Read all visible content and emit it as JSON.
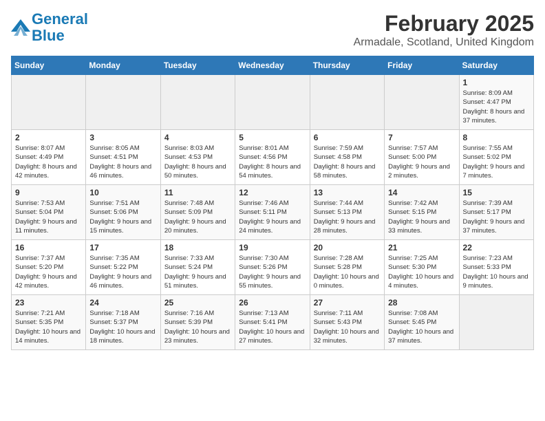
{
  "header": {
    "logo_line1": "General",
    "logo_line2": "Blue",
    "title": "February 2025",
    "subtitle": "Armadale, Scotland, United Kingdom"
  },
  "weekdays": [
    "Sunday",
    "Monday",
    "Tuesday",
    "Wednesday",
    "Thursday",
    "Friday",
    "Saturday"
  ],
  "weeks": [
    [
      {
        "day": "",
        "info": ""
      },
      {
        "day": "",
        "info": ""
      },
      {
        "day": "",
        "info": ""
      },
      {
        "day": "",
        "info": ""
      },
      {
        "day": "",
        "info": ""
      },
      {
        "day": "",
        "info": ""
      },
      {
        "day": "1",
        "info": "Sunrise: 8:09 AM\nSunset: 4:47 PM\nDaylight: 8 hours and 37 minutes."
      }
    ],
    [
      {
        "day": "2",
        "info": "Sunrise: 8:07 AM\nSunset: 4:49 PM\nDaylight: 8 hours and 42 minutes."
      },
      {
        "day": "3",
        "info": "Sunrise: 8:05 AM\nSunset: 4:51 PM\nDaylight: 8 hours and 46 minutes."
      },
      {
        "day": "4",
        "info": "Sunrise: 8:03 AM\nSunset: 4:53 PM\nDaylight: 8 hours and 50 minutes."
      },
      {
        "day": "5",
        "info": "Sunrise: 8:01 AM\nSunset: 4:56 PM\nDaylight: 8 hours and 54 minutes."
      },
      {
        "day": "6",
        "info": "Sunrise: 7:59 AM\nSunset: 4:58 PM\nDaylight: 8 hours and 58 minutes."
      },
      {
        "day": "7",
        "info": "Sunrise: 7:57 AM\nSunset: 5:00 PM\nDaylight: 9 hours and 2 minutes."
      },
      {
        "day": "8",
        "info": "Sunrise: 7:55 AM\nSunset: 5:02 PM\nDaylight: 9 hours and 7 minutes."
      }
    ],
    [
      {
        "day": "9",
        "info": "Sunrise: 7:53 AM\nSunset: 5:04 PM\nDaylight: 9 hours and 11 minutes."
      },
      {
        "day": "10",
        "info": "Sunrise: 7:51 AM\nSunset: 5:06 PM\nDaylight: 9 hours and 15 minutes."
      },
      {
        "day": "11",
        "info": "Sunrise: 7:48 AM\nSunset: 5:09 PM\nDaylight: 9 hours and 20 minutes."
      },
      {
        "day": "12",
        "info": "Sunrise: 7:46 AM\nSunset: 5:11 PM\nDaylight: 9 hours and 24 minutes."
      },
      {
        "day": "13",
        "info": "Sunrise: 7:44 AM\nSunset: 5:13 PM\nDaylight: 9 hours and 28 minutes."
      },
      {
        "day": "14",
        "info": "Sunrise: 7:42 AM\nSunset: 5:15 PM\nDaylight: 9 hours and 33 minutes."
      },
      {
        "day": "15",
        "info": "Sunrise: 7:39 AM\nSunset: 5:17 PM\nDaylight: 9 hours and 37 minutes."
      }
    ],
    [
      {
        "day": "16",
        "info": "Sunrise: 7:37 AM\nSunset: 5:20 PM\nDaylight: 9 hours and 42 minutes."
      },
      {
        "day": "17",
        "info": "Sunrise: 7:35 AM\nSunset: 5:22 PM\nDaylight: 9 hours and 46 minutes."
      },
      {
        "day": "18",
        "info": "Sunrise: 7:33 AM\nSunset: 5:24 PM\nDaylight: 9 hours and 51 minutes."
      },
      {
        "day": "19",
        "info": "Sunrise: 7:30 AM\nSunset: 5:26 PM\nDaylight: 9 hours and 55 minutes."
      },
      {
        "day": "20",
        "info": "Sunrise: 7:28 AM\nSunset: 5:28 PM\nDaylight: 10 hours and 0 minutes."
      },
      {
        "day": "21",
        "info": "Sunrise: 7:25 AM\nSunset: 5:30 PM\nDaylight: 10 hours and 4 minutes."
      },
      {
        "day": "22",
        "info": "Sunrise: 7:23 AM\nSunset: 5:33 PM\nDaylight: 10 hours and 9 minutes."
      }
    ],
    [
      {
        "day": "23",
        "info": "Sunrise: 7:21 AM\nSunset: 5:35 PM\nDaylight: 10 hours and 14 minutes."
      },
      {
        "day": "24",
        "info": "Sunrise: 7:18 AM\nSunset: 5:37 PM\nDaylight: 10 hours and 18 minutes."
      },
      {
        "day": "25",
        "info": "Sunrise: 7:16 AM\nSunset: 5:39 PM\nDaylight: 10 hours and 23 minutes."
      },
      {
        "day": "26",
        "info": "Sunrise: 7:13 AM\nSunset: 5:41 PM\nDaylight: 10 hours and 27 minutes."
      },
      {
        "day": "27",
        "info": "Sunrise: 7:11 AM\nSunset: 5:43 PM\nDaylight: 10 hours and 32 minutes."
      },
      {
        "day": "28",
        "info": "Sunrise: 7:08 AM\nSunset: 5:45 PM\nDaylight: 10 hours and 37 minutes."
      },
      {
        "day": "",
        "info": ""
      }
    ]
  ]
}
